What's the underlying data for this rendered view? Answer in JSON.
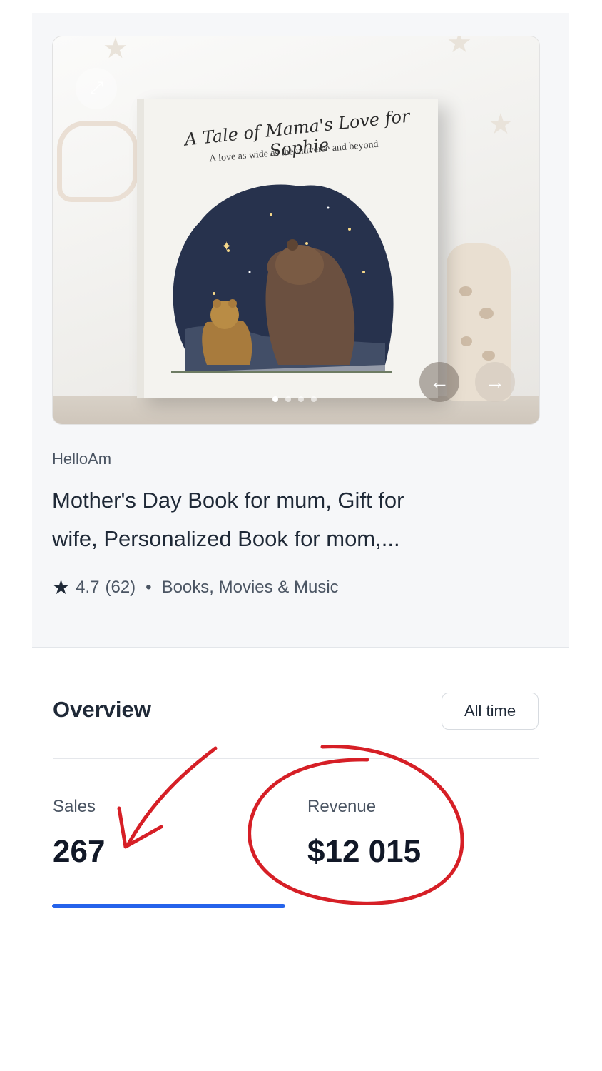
{
  "product": {
    "image": {
      "book_title": "A Tale of Mama's Love for Sophie",
      "book_subtitle": "A love as wide as the universe and beyond",
      "expand_icon": "expand-icon",
      "prev_icon": "arrow-left-icon",
      "next_icon": "arrow-right-icon",
      "slide_count": 4,
      "active_slide": 1
    },
    "shop_name": "HelloAm",
    "title_line1": "Mother's Day Book for mum, Gift for",
    "title_line2": "wife, Personalized Book for mom,...",
    "rating": "4.7",
    "review_count": "(62)",
    "separator": "•",
    "category": "Books, Movies & Music"
  },
  "overview": {
    "title": "Overview",
    "time_range": "All time",
    "stats": {
      "sales": {
        "label": "Sales",
        "value": "267"
      },
      "revenue": {
        "label": "Revenue",
        "value": "$12 015"
      }
    },
    "active_tab": "Sales"
  },
  "colors": {
    "accent": "#2563eb",
    "annotation": "#d61f26"
  }
}
